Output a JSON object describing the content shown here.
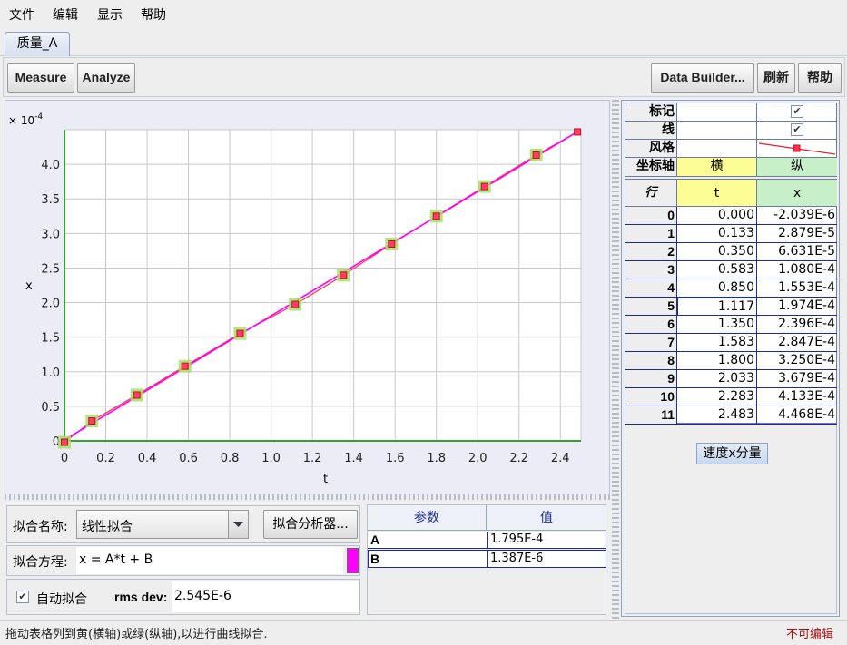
{
  "menu": [
    "文件",
    "编辑",
    "显示",
    "帮助"
  ],
  "tab": "质量_A",
  "toolbar": {
    "measure": "Measure",
    "analyze": "Analyze",
    "data_builder": "Data Builder...",
    "refresh": "刷新",
    "help": "帮助"
  },
  "chart_data": {
    "type": "scatter",
    "xlabel": "t",
    "ylabel": "x",
    "y_multiplier_label": "× 10",
    "y_multiplier_exp": "-4",
    "xlim": [
      0,
      2.5
    ],
    "ylim": [
      0,
      4.5
    ],
    "x_ticks": [
      "0",
      "0.2",
      "0.4",
      "0.6",
      "0.8",
      "1.0",
      "1.2",
      "1.4",
      "1.6",
      "1.8",
      "2.0",
      "2.2",
      "2.4"
    ],
    "y_ticks": [
      "0",
      "0.5",
      "1.0",
      "1.5",
      "2.0",
      "2.5",
      "3.0",
      "3.5",
      "4.0"
    ],
    "series": [
      {
        "x": [
          0.0,
          0.133,
          0.35,
          0.583,
          0.85,
          1.117,
          1.35,
          1.583,
          1.8,
          2.033,
          2.283,
          2.483
        ],
        "y": [
          -0.02039,
          0.2879,
          0.6631,
          1.08,
          1.553,
          1.974,
          2.396,
          2.847,
          3.25,
          3.679,
          4.133,
          4.468
        ]
      }
    ],
    "fit": {
      "A": 1.795,
      "B": 0.01387
    },
    "colors": {
      "marker": "#e8204a",
      "marker_halo": "#a4e06a",
      "line": "#ff00ff",
      "data_line": "#ff3040"
    }
  },
  "fit_panel": {
    "name_label": "拟合名称:",
    "name_value": "线性拟合",
    "analyzer_button": "拟合分析器...",
    "equation_label": "拟合方程:",
    "equation_value": "x = A*t + B",
    "equation_color": "#ff00ff",
    "auto_fit_label": "自动拟合",
    "rms_label": "rms dev:",
    "rms_value": "2.545E-6"
  },
  "params_table": {
    "headers": [
      "参数",
      "值"
    ],
    "rows": [
      {
        "name": "A",
        "value": "1.795E-4"
      },
      {
        "name": "B",
        "value": "1.387E-6"
      }
    ]
  },
  "data_table": {
    "props": {
      "marker_label": "标记",
      "line_label": "线",
      "style_label": "风格",
      "axis_label": "坐标轴",
      "axis_h": "横",
      "axis_v": "纵"
    },
    "headers": [
      "行",
      "t",
      "x"
    ],
    "rows": [
      {
        "i": "0",
        "t": "0.000",
        "x": "-2.039E-6"
      },
      {
        "i": "1",
        "t": "0.133",
        "x": "2.879E-5"
      },
      {
        "i": "2",
        "t": "0.350",
        "x": "6.631E-5"
      },
      {
        "i": "3",
        "t": "0.583",
        "x": "1.080E-4"
      },
      {
        "i": "4",
        "t": "0.850",
        "x": "1.553E-4"
      },
      {
        "i": "5",
        "t": "1.117",
        "x": "1.974E-4"
      },
      {
        "i": "6",
        "t": "1.350",
        "x": "2.396E-4"
      },
      {
        "i": "7",
        "t": "1.583",
        "x": "2.847E-4"
      },
      {
        "i": "8",
        "t": "1.800",
        "x": "3.250E-4"
      },
      {
        "i": "9",
        "t": "2.033",
        "x": "3.679E-4"
      },
      {
        "i": "10",
        "t": "2.283",
        "x": "4.133E-4"
      },
      {
        "i": "11",
        "t": "2.483",
        "x": "4.468E-4"
      }
    ],
    "velocity_button": "速度x分量"
  },
  "status": {
    "hint": "拖动表格列到黄(横轴)或绿(纵轴),以进行曲线拟合.",
    "readonly": "不可编辑"
  }
}
